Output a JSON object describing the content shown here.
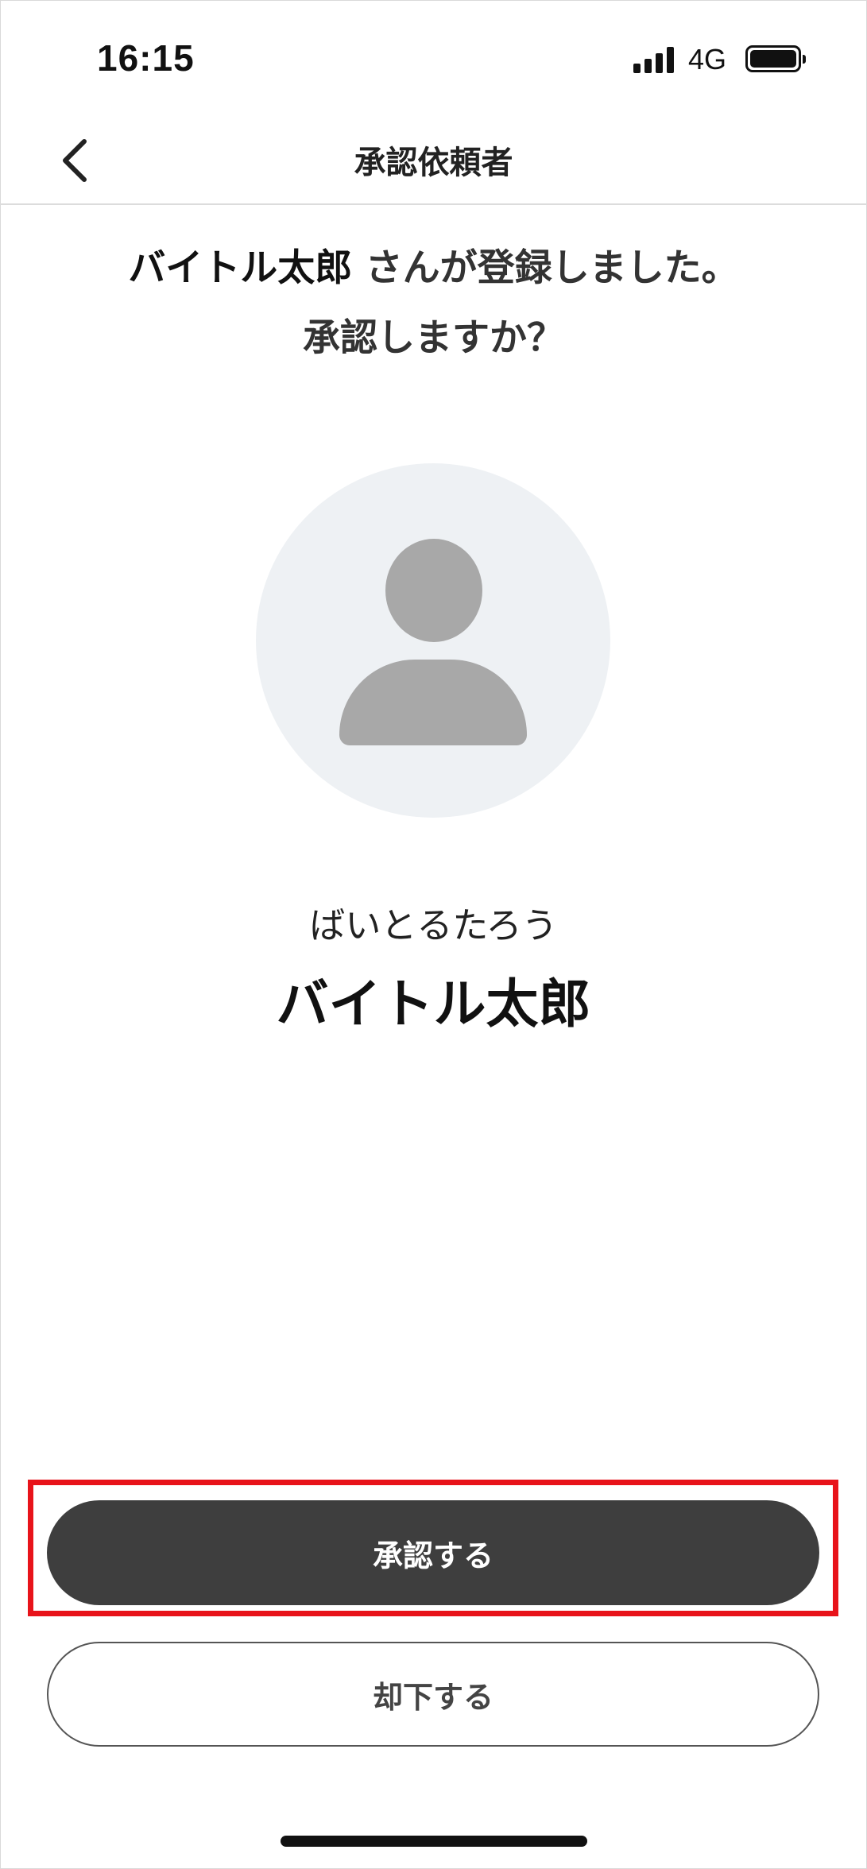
{
  "status_bar": {
    "time": "16:15",
    "network": "4G",
    "signal_icon": "cellular-signal-icon",
    "battery_icon": "battery-full-icon"
  },
  "nav": {
    "title": "承認依頼者",
    "back_icon": "chevron-left-icon"
  },
  "message": {
    "name": "バイトル太郎",
    "line1_suffix": " さんが登録しました。",
    "line2": "承認しますか？"
  },
  "profile": {
    "avatar_icon": "person-placeholder-icon",
    "furigana": "ばいとるたろう",
    "name": "バイトル太郎"
  },
  "actions": {
    "approve_label": "承認する",
    "reject_label": "却下する"
  },
  "colors": {
    "highlight": "#e8131a",
    "primary_button": "#3e3e3e",
    "avatar_bg": "#eef1f4",
    "avatar_fg": "#a8a8a8"
  }
}
